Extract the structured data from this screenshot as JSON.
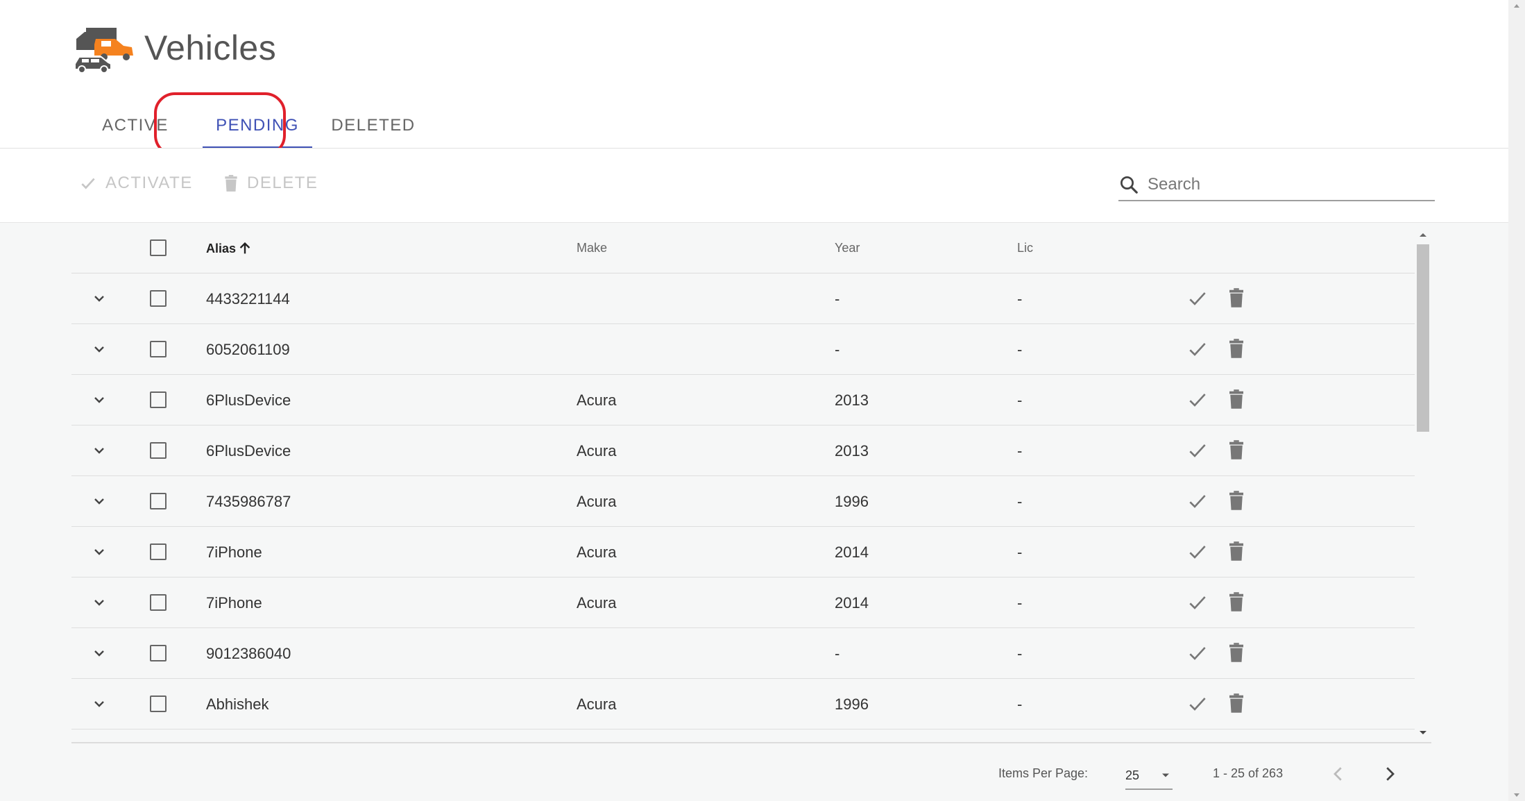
{
  "header": {
    "title": "Vehicles",
    "logo_icon": "vehicles-logo-icon"
  },
  "tabs": [
    {
      "label": "ACTIVE"
    },
    {
      "label": "PENDING",
      "active": true
    },
    {
      "label": "DELETED"
    }
  ],
  "toolbar": {
    "activate_label": "ACTIVATE",
    "delete_label": "DELETE",
    "search_placeholder": "Search"
  },
  "table": {
    "columns": {
      "alias": "Alias",
      "make": "Make",
      "year": "Year",
      "lic": "Lic"
    },
    "rows": [
      {
        "alias": "4433221144",
        "make": "",
        "year": "-",
        "lic": "-"
      },
      {
        "alias": "6052061109",
        "make": "",
        "year": "-",
        "lic": "-"
      },
      {
        "alias": "6PlusDevice",
        "make": "Acura",
        "year": "2013",
        "lic": "-"
      },
      {
        "alias": "6PlusDevice",
        "make": "Acura",
        "year": "2013",
        "lic": "-"
      },
      {
        "alias": "7435986787",
        "make": "Acura",
        "year": "1996",
        "lic": "-"
      },
      {
        "alias": "7iPhone",
        "make": "Acura",
        "year": "2014",
        "lic": "-"
      },
      {
        "alias": "7iPhone",
        "make": "Acura",
        "year": "2014",
        "lic": "-"
      },
      {
        "alias": "9012386040",
        "make": "",
        "year": "-",
        "lic": "-"
      },
      {
        "alias": "Abhishek",
        "make": "Acura",
        "year": "1996",
        "lic": "-"
      }
    ]
  },
  "pagination": {
    "items_per_page_label": "Items Per Page:",
    "items_per_page_value": "25",
    "range_label": "1 - 25 of 263"
  },
  "colors": {
    "accent": "#3f51b5",
    "highlight": "#e0202b",
    "logo_orange": "#f5821f"
  }
}
